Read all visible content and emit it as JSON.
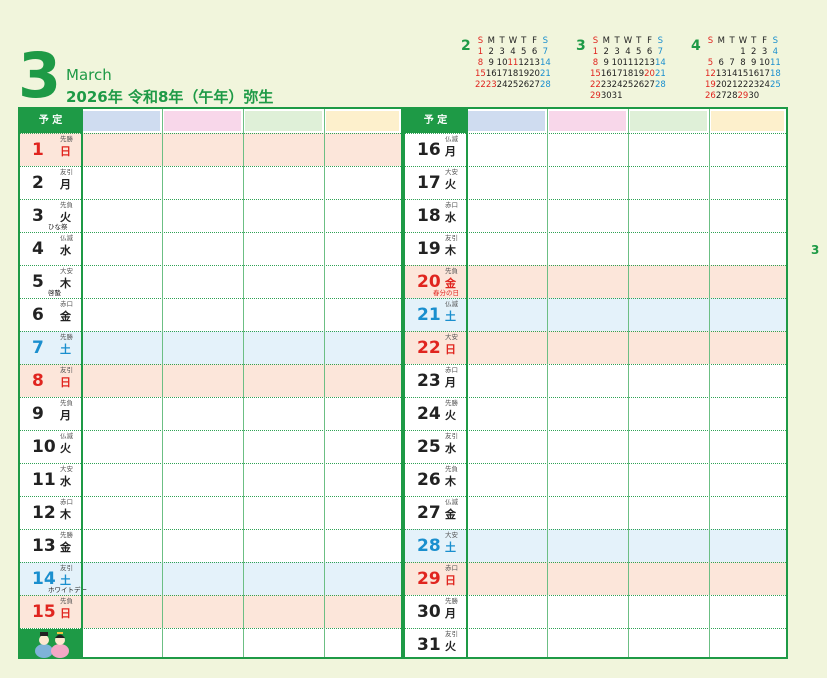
{
  "header": {
    "month_number": "3",
    "month_name": "March",
    "year_line": "2026年  令和8年（午年）弥生",
    "side_page_number": "3"
  },
  "mini_calendars": [
    {
      "month": "2",
      "weekdays": [
        "S",
        "M",
        "T",
        "W",
        "T",
        "F",
        "S"
      ],
      "weeks": [
        [
          "1",
          "2",
          "3",
          "4",
          "5",
          "6",
          "7"
        ],
        [
          "8",
          "9",
          "10",
          "11",
          "12",
          "13",
          "14"
        ],
        [
          "15",
          "16",
          "17",
          "18",
          "19",
          "20",
          "21"
        ],
        [
          "22",
          "23",
          "24",
          "25",
          "26",
          "27",
          "28"
        ]
      ],
      "holidays": [
        "11",
        "23"
      ]
    },
    {
      "month": "3",
      "weekdays": [
        "S",
        "M",
        "T",
        "W",
        "T",
        "F",
        "S"
      ],
      "weeks": [
        [
          "1",
          "2",
          "3",
          "4",
          "5",
          "6",
          "7"
        ],
        [
          "8",
          "9",
          "10",
          "11",
          "12",
          "13",
          "14"
        ],
        [
          "15",
          "16",
          "17",
          "18",
          "19",
          "20",
          "21"
        ],
        [
          "22",
          "23",
          "24",
          "25",
          "26",
          "27",
          "28"
        ],
        [
          "29",
          "30",
          "31",
          "",
          "",
          "",
          ""
        ]
      ],
      "holidays": [
        "20"
      ]
    },
    {
      "month": "4",
      "weekdays": [
        "S",
        "M",
        "T",
        "W",
        "T",
        "F",
        "S"
      ],
      "weeks": [
        [
          "",
          "",
          "",
          "1",
          "2",
          "3",
          "4"
        ],
        [
          "5",
          "6",
          "7",
          "8",
          "9",
          "10",
          "11"
        ],
        [
          "12",
          "13",
          "14",
          "15",
          "16",
          "17",
          "18"
        ],
        [
          "19",
          "20",
          "21",
          "22",
          "23",
          "24",
          "25"
        ],
        [
          "26",
          "27",
          "28",
          "29",
          "30",
          "",
          ""
        ]
      ],
      "holidays": [
        "29"
      ]
    }
  ],
  "schedule_label": "予 定",
  "column_colors": [
    "#cfdcf0",
    "#f8d7ea",
    "#dff0d8",
    "#fdf0cc"
  ],
  "left_days": [
    {
      "day": "1",
      "weekday": "日",
      "rokuyo": "先勝",
      "type": "sun",
      "holiday": ""
    },
    {
      "day": "2",
      "weekday": "月",
      "rokuyo": "友引",
      "type": "",
      "holiday": ""
    },
    {
      "day": "3",
      "weekday": "火",
      "rokuyo": "先負",
      "type": "",
      "holiday": "ひな祭"
    },
    {
      "day": "4",
      "weekday": "水",
      "rokuyo": "仏滅",
      "type": "",
      "holiday": ""
    },
    {
      "day": "5",
      "weekday": "木",
      "rokuyo": "大安",
      "type": "",
      "holiday": "啓蟄"
    },
    {
      "day": "6",
      "weekday": "金",
      "rokuyo": "赤口",
      "type": "",
      "holiday": ""
    },
    {
      "day": "7",
      "weekday": "土",
      "rokuyo": "先勝",
      "type": "sat",
      "holiday": ""
    },
    {
      "day": "8",
      "weekday": "日",
      "rokuyo": "友引",
      "type": "sun",
      "holiday": ""
    },
    {
      "day": "9",
      "weekday": "月",
      "rokuyo": "先負",
      "type": "",
      "holiday": ""
    },
    {
      "day": "10",
      "weekday": "火",
      "rokuyo": "仏滅",
      "type": "",
      "holiday": ""
    },
    {
      "day": "11",
      "weekday": "水",
      "rokuyo": "大安",
      "type": "",
      "holiday": ""
    },
    {
      "day": "12",
      "weekday": "木",
      "rokuyo": "赤口",
      "type": "",
      "holiday": ""
    },
    {
      "day": "13",
      "weekday": "金",
      "rokuyo": "先勝",
      "type": "",
      "holiday": ""
    },
    {
      "day": "14",
      "weekday": "土",
      "rokuyo": "友引",
      "type": "sat",
      "holiday": "ホワイトデー"
    },
    {
      "day": "15",
      "weekday": "日",
      "rokuyo": "先負",
      "type": "sun",
      "holiday": ""
    }
  ],
  "right_days": [
    {
      "day": "16",
      "weekday": "月",
      "rokuyo": "仏滅",
      "type": "",
      "holiday": ""
    },
    {
      "day": "17",
      "weekday": "火",
      "rokuyo": "大安",
      "type": "",
      "holiday": ""
    },
    {
      "day": "18",
      "weekday": "水",
      "rokuyo": "赤口",
      "type": "",
      "holiday": ""
    },
    {
      "day": "19",
      "weekday": "木",
      "rokuyo": "友引",
      "type": "",
      "holiday": ""
    },
    {
      "day": "20",
      "weekday": "金",
      "rokuyo": "先負",
      "type": "sun",
      "holiday": "春分の日"
    },
    {
      "day": "21",
      "weekday": "土",
      "rokuyo": "仏滅",
      "type": "sat",
      "holiday": ""
    },
    {
      "day": "22",
      "weekday": "日",
      "rokuyo": "大安",
      "type": "sun",
      "holiday": ""
    },
    {
      "day": "23",
      "weekday": "月",
      "rokuyo": "赤口",
      "type": "",
      "holiday": ""
    },
    {
      "day": "24",
      "weekday": "火",
      "rokuyo": "先勝",
      "type": "",
      "holiday": ""
    },
    {
      "day": "25",
      "weekday": "水",
      "rokuyo": "友引",
      "type": "",
      "holiday": ""
    },
    {
      "day": "26",
      "weekday": "木",
      "rokuyo": "先負",
      "type": "",
      "holiday": ""
    },
    {
      "day": "27",
      "weekday": "金",
      "rokuyo": "仏滅",
      "type": "",
      "holiday": ""
    },
    {
      "day": "28",
      "weekday": "土",
      "rokuyo": "大安",
      "type": "sat",
      "holiday": ""
    },
    {
      "day": "29",
      "weekday": "日",
      "rokuyo": "赤口",
      "type": "sun",
      "holiday": ""
    },
    {
      "day": "30",
      "weekday": "月",
      "rokuyo": "先勝",
      "type": "",
      "holiday": ""
    },
    {
      "day": "31",
      "weekday": "火",
      "rokuyo": "友引",
      "type": "",
      "holiday": ""
    }
  ],
  "decoration_icon": "hina-dolls-icon"
}
